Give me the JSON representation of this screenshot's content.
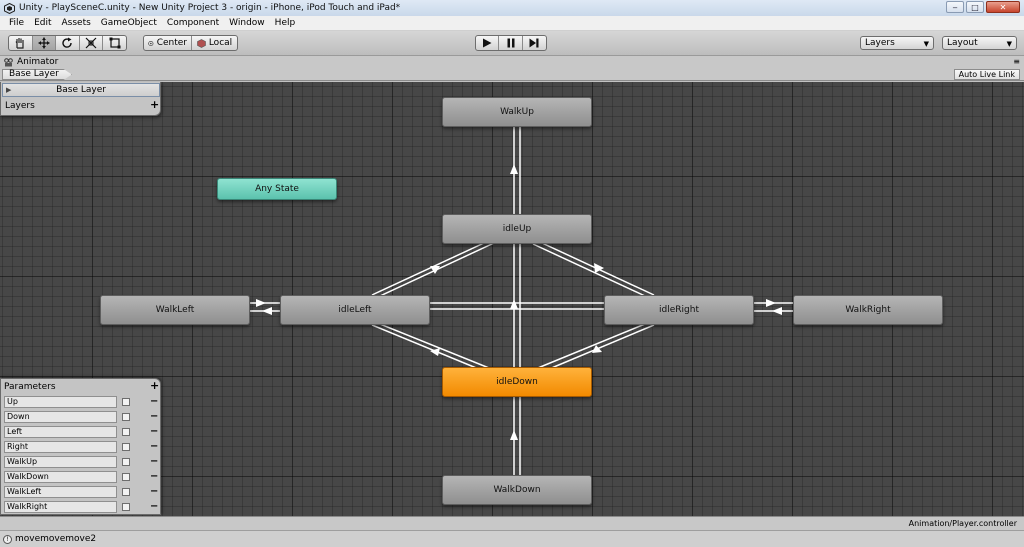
{
  "window": {
    "title": "Unity - PlaySceneC.unity - New Unity Project 3 - origin - iPhone, iPod Touch and iPad*",
    "minimize": "‒",
    "maximize": "□",
    "close": "✕"
  },
  "menu": [
    "File",
    "Edit",
    "Assets",
    "GameObject",
    "Component",
    "Window",
    "Help"
  ],
  "toolbar": {
    "transform_tools": [
      "hand-icon",
      "move-icon",
      "rotate-icon",
      "scale-icon",
      "rect-icon"
    ],
    "pivot_label": "Center",
    "space_label": "Local",
    "layers_dropdown": "Layers",
    "layout_dropdown": "Layout"
  },
  "animator": {
    "tab_title": "Animator",
    "breadcrumb": "Base Layer",
    "auto_live_link": "Auto Live Link",
    "layers_panel": {
      "selected_layer": "Base Layer",
      "label": "Layers",
      "add": "+"
    },
    "states": {
      "any_state": "Any State",
      "walk_up": "WalkUp",
      "idle_up": "idleUp",
      "walk_left": "WalkLeft",
      "idle_left": "idleLeft",
      "idle_right": "idleRight",
      "walk_right": "WalkRight",
      "idle_down": "idleDown",
      "walk_down": "WalkDown"
    },
    "default_state": "idleDown",
    "parameters": {
      "title": "Parameters",
      "add": "+",
      "remove": "−",
      "items": [
        {
          "name": "Up",
          "checked": false
        },
        {
          "name": "Down",
          "checked": false
        },
        {
          "name": "Left",
          "checked": false
        },
        {
          "name": "Right",
          "checked": false
        },
        {
          "name": "WalkUp",
          "checked": false
        },
        {
          "name": "WalkDown",
          "checked": false
        },
        {
          "name": "WalkLeft",
          "checked": false
        },
        {
          "name": "WalkRight",
          "checked": false
        }
      ]
    },
    "controller_path": "Animation/Player.controller"
  },
  "console": {
    "message": "movemovemove2"
  },
  "colors": {
    "default_state": "#f28a00",
    "any_state": "#5bc2ad",
    "canvas": "#474747"
  }
}
